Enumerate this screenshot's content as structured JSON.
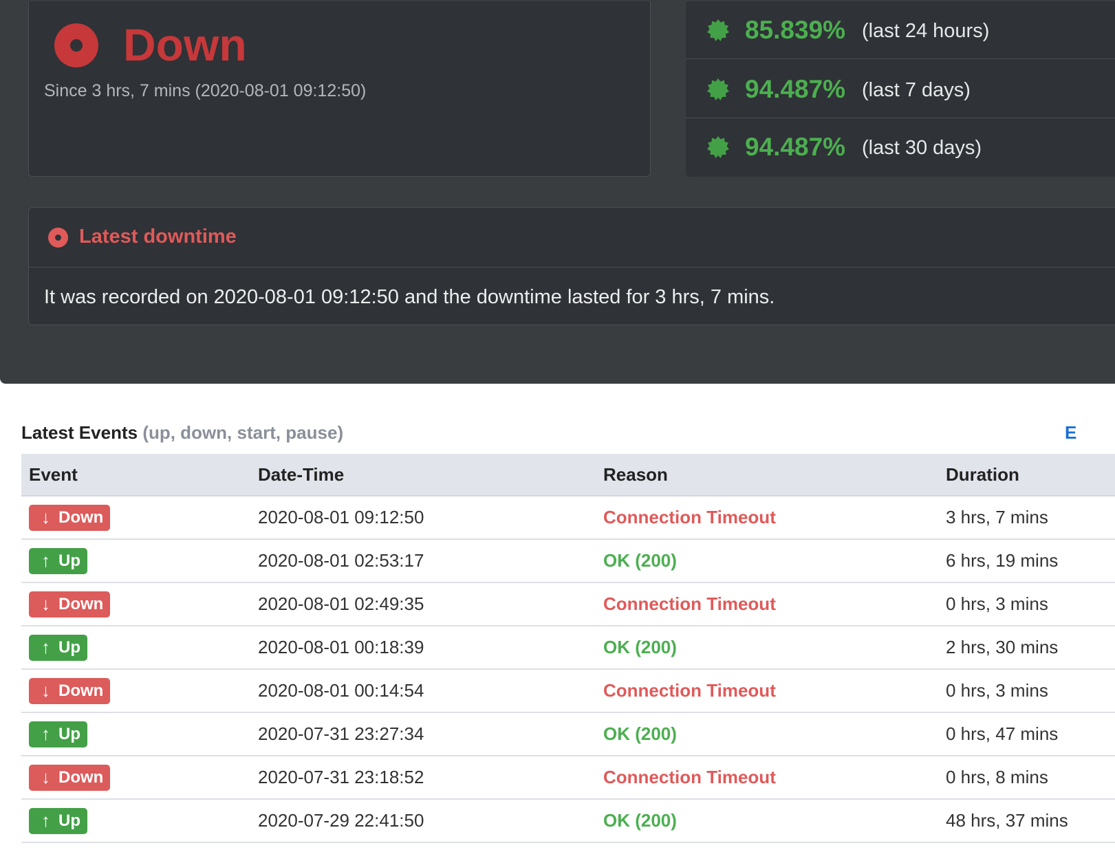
{
  "status": {
    "title": "Down",
    "since": "Since 3 hrs, 7 mins (2020-08-01 09:12:50)",
    "color": "#c6383a"
  },
  "uptime": [
    {
      "percent": "85.839%",
      "period": "(last 24 hours)"
    },
    {
      "percent": "94.487%",
      "period": "(last 7 days)"
    },
    {
      "percent": "94.487%",
      "period": "(last 30 days)"
    }
  ],
  "latest_downtime": {
    "title": "Latest downtime",
    "text": "It was recorded on 2020-08-01 09:12:50 and the downtime lasted for 3 hrs, 7 mins."
  },
  "events": {
    "heading": "Latest Events",
    "subheading": "(up, down, start, pause)",
    "export_label": "E",
    "columns": [
      "Event",
      "Date-Time",
      "Reason",
      "Duration"
    ],
    "rows": [
      {
        "type": "down",
        "event": "Down",
        "datetime": "2020-08-01 09:12:50",
        "reason": "Connection Timeout",
        "duration": "3 hrs, 7 mins"
      },
      {
        "type": "up",
        "event": "Up",
        "datetime": "2020-08-01 02:53:17",
        "reason": "OK (200)",
        "duration": "6 hrs, 19 mins"
      },
      {
        "type": "down",
        "event": "Down",
        "datetime": "2020-08-01 02:49:35",
        "reason": "Connection Timeout",
        "duration": "0 hrs, 3 mins"
      },
      {
        "type": "up",
        "event": "Up",
        "datetime": "2020-08-01 00:18:39",
        "reason": "OK (200)",
        "duration": "2 hrs, 30 mins"
      },
      {
        "type": "down",
        "event": "Down",
        "datetime": "2020-08-01 00:14:54",
        "reason": "Connection Timeout",
        "duration": "0 hrs, 3 mins"
      },
      {
        "type": "up",
        "event": "Up",
        "datetime": "2020-07-31 23:27:34",
        "reason": "OK (200)",
        "duration": "0 hrs, 47 mins"
      },
      {
        "type": "down",
        "event": "Down",
        "datetime": "2020-07-31 23:18:52",
        "reason": "Connection Timeout",
        "duration": "0 hrs, 8 mins"
      },
      {
        "type": "up",
        "event": "Up",
        "datetime": "2020-07-29 22:41:50",
        "reason": "OK (200)",
        "duration": "48 hrs, 37 mins"
      }
    ]
  },
  "colors": {
    "down": "#dc5b5b",
    "up": "#43a047",
    "reason_down": "#e05a5a",
    "reason_up": "#4caf50"
  }
}
